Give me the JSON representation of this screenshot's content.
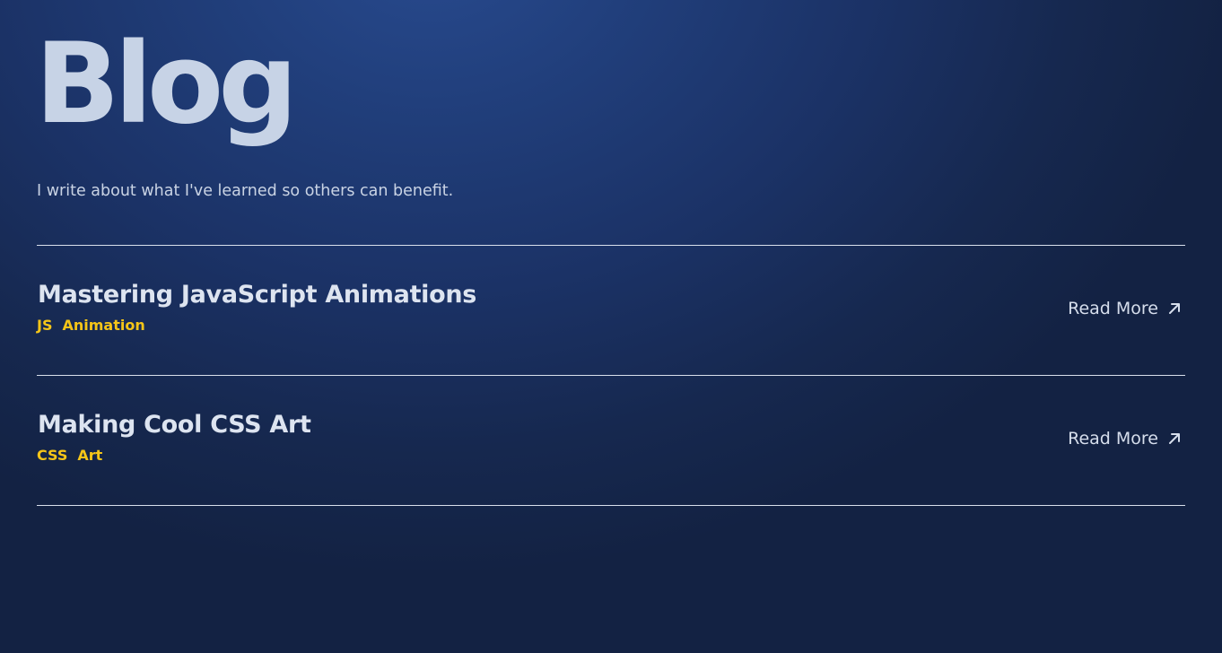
{
  "header": {
    "title": "Blog",
    "subtitle": "I write about what I've learned so others can benefit."
  },
  "posts": [
    {
      "title": "Mastering JavaScript Animations",
      "tags": [
        "JS",
        "Animation"
      ],
      "link_label": "Read More",
      "link_icon": "arrow-up-right-icon"
    },
    {
      "title": "Making Cool CSS Art",
      "tags": [
        "CSS",
        "Art"
      ],
      "link_label": "Read More",
      "link_icon": "arrow-up-right-icon"
    }
  ],
  "colors": {
    "background": "#1b3266",
    "title": "#c7d3e6",
    "tag": "#f5c518",
    "divider": "#d9e0ec"
  }
}
